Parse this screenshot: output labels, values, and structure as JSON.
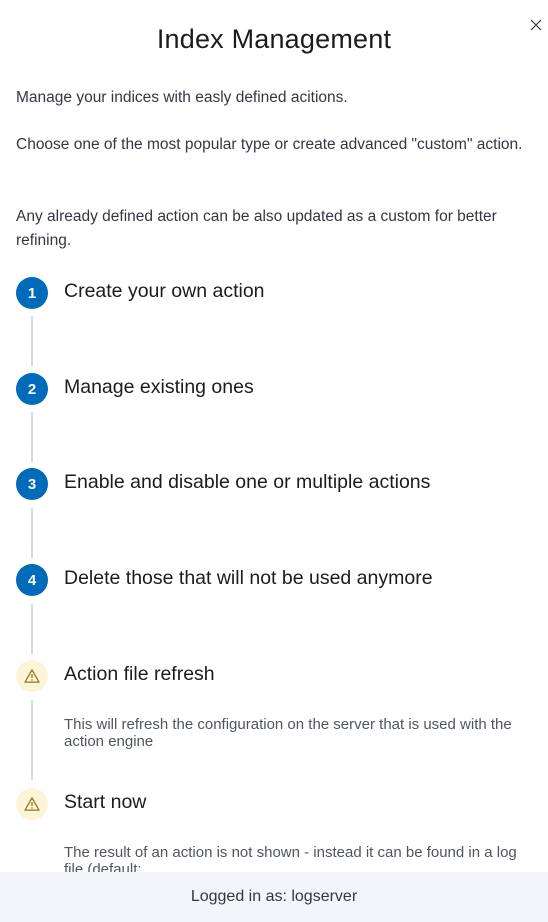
{
  "flyout": {
    "title": "Index Management",
    "close_icon": "close-icon"
  },
  "intro": {
    "line1": "Manage your indices with easly defined acitions.",
    "line2": "Choose one of the most popular type or create advanced \"custom\" action.",
    "line3": "Any already defined action can be also updated as a custom for better refining."
  },
  "steps": [
    {
      "marker": "1",
      "title": "Create your own action"
    },
    {
      "marker": "2",
      "title": "Manage existing ones"
    },
    {
      "marker": "3",
      "title": "Enable and disable one or multiple actions"
    },
    {
      "marker": "4",
      "title": "Delete those that will not be used anymore"
    },
    {
      "icon": "warning-icon",
      "title": "Action file refresh",
      "body": "This will refresh the configuration on the server that is used with the action engine"
    },
    {
      "icon": "warning-icon",
      "title": "Start now",
      "body": "The result of an action is not shown - instead it can be found in a log file (default:"
    }
  ],
  "footer": {
    "text": "Logged in as: logserver"
  },
  "colors": {
    "step_accent": "#006bb8",
    "warning_bg": "#fdf3d8",
    "warning_icon": "#8a6a0a",
    "footer_bg": "#f3f5f9"
  }
}
